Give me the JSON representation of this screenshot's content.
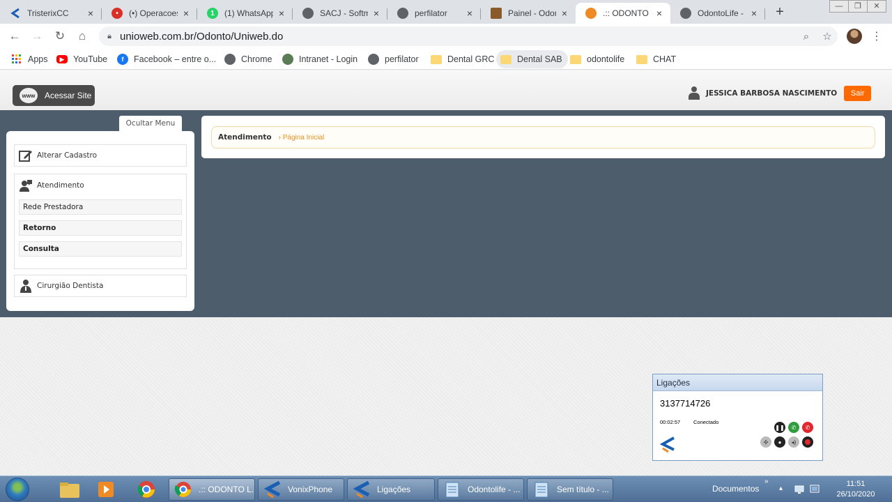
{
  "browser": {
    "tabs": [
      {
        "title": "TristerixCC",
        "favicon": "tristerix-icon",
        "color": "#1a5fb4"
      },
      {
        "title": "(•) Operacoes",
        "favicon": "chat-icon",
        "color": "#d93025"
      },
      {
        "title": "(1) WhatsApp",
        "favicon": "whatsapp-icon",
        "color": "#25d366"
      },
      {
        "title": "SACJ - Softm",
        "favicon": "globe-icon",
        "color": "#5f6368"
      },
      {
        "title": "perfilator",
        "favicon": "globe-icon",
        "color": "#5f6368"
      },
      {
        "title": "Painel - Odon",
        "favicon": "painel-icon",
        "color": "#8a5a2b"
      },
      {
        "title": ".:: ODONTO L",
        "favicon": "odonto-icon",
        "color": "#f08a24"
      },
      {
        "title": "OdontoLife -",
        "favicon": "globe-icon",
        "color": "#5f6368"
      }
    ],
    "new_tab_label": "+",
    "url": "unioweb.com.br/Odonto/Uniweb.do",
    "bookmarks": [
      {
        "label": "Apps",
        "icon": "apps-grid-icon"
      },
      {
        "label": "YouTube",
        "icon": "youtube-icon"
      },
      {
        "label": "Facebook – entre o...",
        "icon": "facebook-icon"
      },
      {
        "label": "Chrome",
        "icon": "globe-icon"
      },
      {
        "label": "Intranet - Login",
        "icon": "globe-icon"
      },
      {
        "label": "perfilator",
        "icon": "globe-icon"
      },
      {
        "label": "Dental GRC",
        "icon": "folder-icon"
      },
      {
        "label": "Dental SAB",
        "icon": "folder-icon"
      },
      {
        "label": "odontolife",
        "icon": "folder-icon"
      },
      {
        "label": "CHAT",
        "icon": "folder-icon"
      }
    ]
  },
  "header": {
    "acessar_site": "Acessar Site",
    "www_label": "www",
    "user_name": "JESSICA BARBOSA NASCIMENTO",
    "logout": "Sair"
  },
  "sidebar": {
    "toggle": "Ocultar Menu",
    "alterar_cadastro": "Alterar Cadastro",
    "atendimento": "Atendimento",
    "atendimento_items": [
      "Rede Prestadora",
      "Retorno",
      "Consulta"
    ],
    "cirurgiao": "Cirurgião Dentista"
  },
  "breadcrumb": {
    "section": "Atendimento",
    "page": "Página Inicial"
  },
  "ligacoes": {
    "title": "Ligações",
    "number": "3137714726",
    "duration": "00:02:57",
    "status": "Conectado"
  },
  "taskbar": {
    "windows": [
      {
        "label": ".:: ODONTO L...",
        "icon": "chrome-icon"
      },
      {
        "label": "VonixPhone",
        "icon": "vonix-icon"
      },
      {
        "label": "Ligações",
        "icon": "vonix-icon"
      },
      {
        "label": "Odontolife - ...",
        "icon": "notepad-icon"
      },
      {
        "label": "Sem título - ...",
        "icon": "notepad-icon"
      }
    ],
    "documents": "Documentos",
    "time": "11:51",
    "date": "26/10/2020"
  },
  "colors": {
    "accent_orange": "#ff6a00",
    "content_bg": "#4e5d6c",
    "breadcrumb_link": "#e8901a"
  }
}
